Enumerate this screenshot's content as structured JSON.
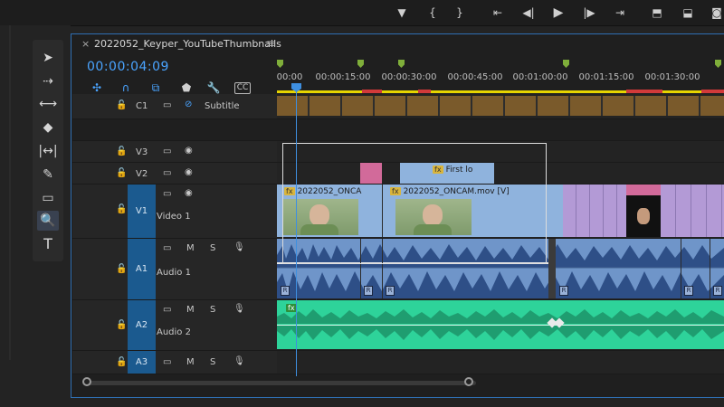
{
  "top_controls": {
    "buttons": [
      "marker-icon",
      "in-point-icon",
      "out-point-icon",
      "go-to-in-icon",
      "step-back-icon",
      "play-icon",
      "step-forward-icon",
      "go-to-out-icon",
      "insert-icon",
      "overwrite-icon",
      "camera-icon"
    ]
  },
  "tools": [
    "selection",
    "track-select",
    "ripple-edit",
    "razor",
    "slip",
    "pen",
    "rectangle",
    "zoom",
    "type"
  ],
  "sequence": {
    "tab_title": "2022052_Keyper_YouTubeThumbnails",
    "tab_close": "×",
    "tab_menu": "≡",
    "timecode": "00:00:04:09"
  },
  "ruler": {
    "labels": [
      "00:00",
      "00:00:15:00",
      "00:00:30:00",
      "00:00:45:00",
      "00:01:00:00",
      "00:01:15:00",
      "00:01:30:00"
    ]
  },
  "tracks": {
    "caption": {
      "id": "C1",
      "name": "Subtitle"
    },
    "v3": {
      "id": "V3"
    },
    "v2": {
      "id": "V2"
    },
    "v1": {
      "id": "V1",
      "name": "Video 1"
    },
    "a1": {
      "id": "A1",
      "name": "Audio 1"
    },
    "a2": {
      "id": "A2",
      "name": "Audio 2"
    },
    "a3": {
      "id": "A3"
    }
  },
  "track_controls": {
    "mute": "M",
    "solo": "S"
  },
  "clips": {
    "v2_title": "First lo",
    "v1_clip1": "2022052_ONCA",
    "v1_clip2": "2022052_ONCAM.mov [V]",
    "fx": "fx",
    "r": "R"
  },
  "colors": {
    "accent": "#2f6fb3",
    "timecode": "#4aa4ff",
    "video_clip": "#8fb3dd",
    "purple_clip": "#b39ad6",
    "pink_clip": "#d26a9a",
    "audio1": "#6f95c9",
    "audio2": "#2ed39a",
    "track_target": "#1b5a8f"
  }
}
